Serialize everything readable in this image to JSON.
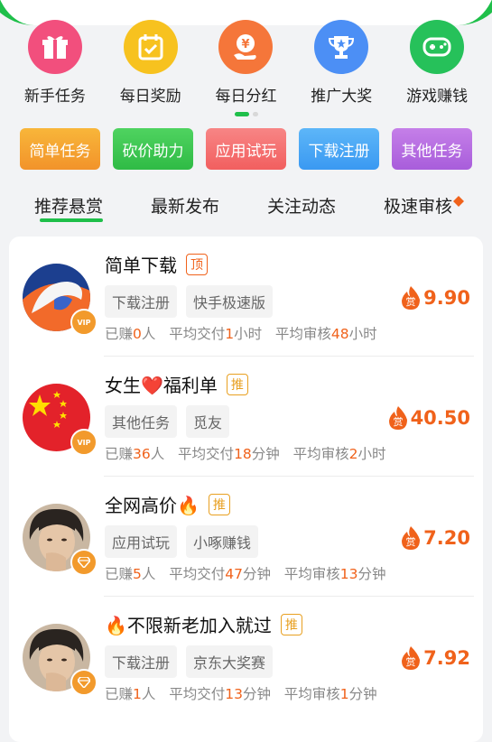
{
  "nav": [
    {
      "label": "新手任务",
      "icon": "gift-icon",
      "color": "#f24f7d"
    },
    {
      "label": "每日奖励",
      "icon": "calendar-check-icon",
      "color": "#f7c21f"
    },
    {
      "label": "每日分红",
      "icon": "yen-hand-icon",
      "color": "#f5763a"
    },
    {
      "label": "推广大奖",
      "icon": "trophy-icon",
      "color": "#4c8ff5"
    },
    {
      "label": "游戏赚钱",
      "icon": "gamepad-icon",
      "color": "#26c15a"
    }
  ],
  "chips": [
    {
      "label": "简单任务",
      "color": "#f6a12a"
    },
    {
      "label": "砍价助力",
      "color": "#3cc74f"
    },
    {
      "label": "应用试玩",
      "color": "#f56b6b"
    },
    {
      "label": "下载注册",
      "color": "#4aa7f5"
    },
    {
      "label": "其他任务",
      "color": "#b56ce0"
    }
  ],
  "tabs": [
    "推荐悬赏",
    "最新发布",
    "关注动态",
    "极速审核"
  ],
  "rows": [
    {
      "title": "简单下载",
      "badge": "顶",
      "badge_color": "#f0621b",
      "tags": [
        "下载注册",
        "快手极速版"
      ],
      "reward": "9.90",
      "s1a": "已赚",
      "s1n": "0",
      "s1b": "人",
      "s2a": "平均交付",
      "s2n": "1",
      "s2b": "小时",
      "s3a": "平均审核",
      "s3n": "48",
      "s3b": "小时",
      "avatar": "swirl",
      "vip": "VIP"
    },
    {
      "title": "女生❤️福利单",
      "badge": "推",
      "badge_color": "#e8a021",
      "tags": [
        "其他任务",
        "觅友"
      ],
      "reward": "40.50",
      "s1a": "已赚",
      "s1n": "36",
      "s1b": "人",
      "s2a": "平均交付",
      "s2n": "18",
      "s2b": "分钟",
      "s3a": "平均审核",
      "s3n": "2",
      "s3b": "小时",
      "avatar": "flag",
      "vip": "VIP"
    },
    {
      "title": "全网高价🔥",
      "badge": "推",
      "badge_color": "#e8a021",
      "tags": [
        "应用试玩",
        "小啄赚钱"
      ],
      "reward": "7.20",
      "s1a": "已赚",
      "s1n": "5",
      "s1b": "人",
      "s2a": "平均交付",
      "s2n": "47",
      "s2b": "分钟",
      "s3a": "平均审核",
      "s3n": "13",
      "s3b": "分钟",
      "avatar": "person",
      "vip": ""
    },
    {
      "title": "🔥不限新老加入就过",
      "badge": "推",
      "badge_color": "#e8a021",
      "tags": [
        "下载注册",
        "京东大奖赛"
      ],
      "reward": "7.92",
      "s1a": "已赚",
      "s1n": "1",
      "s1b": "人",
      "s2a": "平均交付",
      "s2n": "13",
      "s2b": "分钟",
      "s3a": "平均审核",
      "s3n": "1",
      "s3b": "分钟",
      "avatar": "person",
      "vip": ""
    }
  ],
  "reward_label": "赏"
}
